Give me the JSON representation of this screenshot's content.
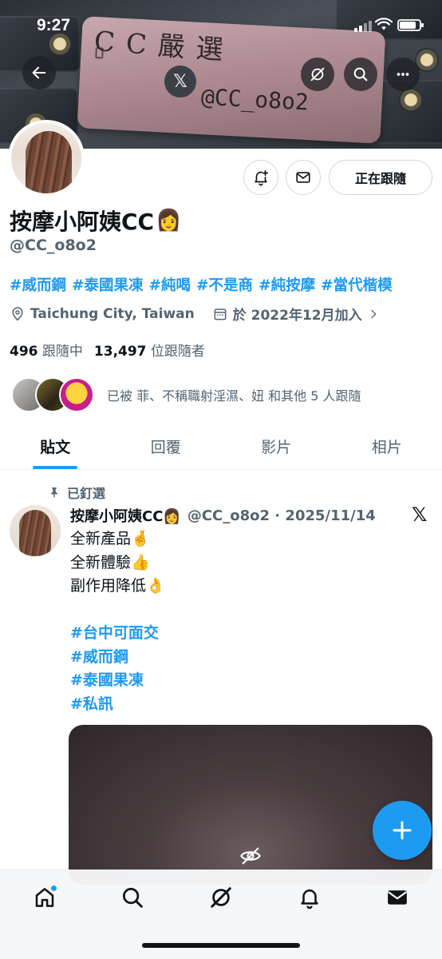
{
  "status_bar": {
    "time": "9:27",
    "battery_level_percent": 85
  },
  "banner": {
    "brand_text": "CC嚴選",
    "printed_handle": "@CC_o8o2"
  },
  "header_buttons": {
    "back": "back-arrow-icon",
    "grok": "grok-icon",
    "search": "search-icon",
    "more": "more-icon"
  },
  "profile": {
    "display_name": "按摩小阿姨CC",
    "name_emoji": "👩",
    "handle": "@CC_o8o2",
    "follow_button_label": "正在跟隨",
    "hashtags": [
      "#威而鋼",
      "#泰國果凍",
      "#純喝",
      "#不是商",
      "#純按摩",
      "#當代楷模"
    ],
    "location": "Taichung City, Taiwan",
    "joined": "於 2022年12月加入",
    "following_count": "496",
    "following_label": "跟隨中",
    "followers_count": "13,497",
    "followers_label": "位跟隨者",
    "followed_by_text": "已被 菲、不稱職射淫濕、妞 和其他 5 人跟隨"
  },
  "tabs": [
    {
      "label": "貼文",
      "active": true
    },
    {
      "label": "回覆",
      "active": false
    },
    {
      "label": "影片",
      "active": false
    },
    {
      "label": "相片",
      "active": false
    }
  ],
  "tweet": {
    "pinned_label": "已釘選",
    "author_name": "按摩小阿姨CC",
    "author_emoji": "👩",
    "author_handle_date": "@CC_o8o2 · 2025/11/14",
    "lines": [
      {
        "text": "全新產品🤞",
        "tag": false
      },
      {
        "text": "全新體驗👍",
        "tag": false
      },
      {
        "text": "副作用降低👌",
        "tag": false
      },
      {
        "text": "",
        "tag": false
      },
      {
        "text": "#台中可面交",
        "tag": true
      },
      {
        "text": "#威而鋼",
        "tag": true
      },
      {
        "text": "#泰國果凍",
        "tag": true
      },
      {
        "text": "#私訊",
        "tag": true
      }
    ]
  },
  "colors": {
    "accent": "#1d9bf0",
    "text": "#0f1419",
    "muted": "#536471",
    "border": "#cfd9de"
  },
  "bottom_nav": [
    "home-icon",
    "search-icon",
    "grok-icon",
    "notifications-icon",
    "messages-icon"
  ]
}
